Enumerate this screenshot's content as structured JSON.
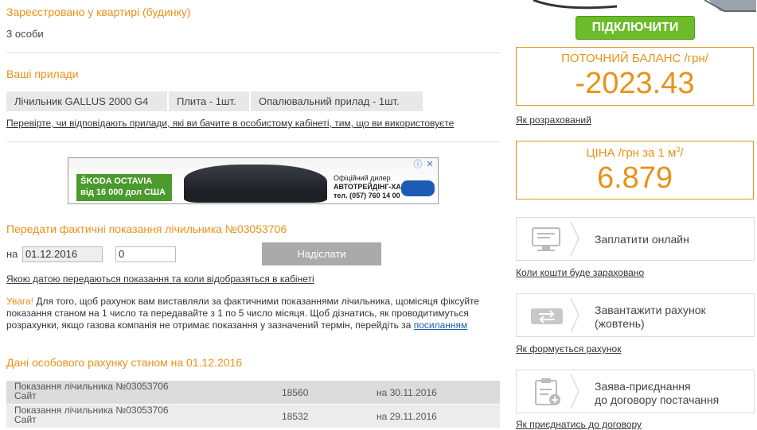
{
  "registered": {
    "heading": "Зареєстровано у квартирі (будинку)",
    "value": "3 особи"
  },
  "devices": {
    "heading": "Ваші прилади",
    "items": [
      "Лічильник GALLUS 2000 G4",
      "Плита - 1шт.",
      "Опалювальний прилад - 1шт."
    ],
    "check_link": "Перевірте, чи відповідають прилади, які ви бачите в особистому кабінеті, тим, що ви використовуєте"
  },
  "ad": {
    "brand": "ŠKODA OCTAVIA",
    "offer": "від 16 000 дол США",
    "dealer_label": "Офіційний дилер",
    "dealer_name": "АВТОТРЕЙДІНГ-ХАРКІВ",
    "phone": "тел. (057) 760 14 00",
    "info_icon": "info-icon",
    "close_icon": "close-icon"
  },
  "reading_form": {
    "heading": "Передати фактичні показання лічильника №03053706",
    "date_prefix": "на",
    "date_value": "01.12.2016",
    "reading_value": "0",
    "submit_label": "Надіслати",
    "help_link": "Якою датою передаються показання та коли відобразяться в кабінеті"
  },
  "notice": {
    "warn": "Увага!",
    "text": " Для того, щоб рахунок вам виставляли за фактичними показаннями лічильника, щомісяця фіксуйте показання станом на 1 число та передавайте з 1 по 5 число місяця. Щоб дізнатись, як проводитимуться розрахунки, якщо газова компанія не отримає показання у зазначений термін, перейдіть за ",
    "link": "посиланням"
  },
  "account": {
    "heading": "Дані особового рахунку станом на 01.12.2016",
    "rows": [
      {
        "title": "Показання лічильника №03053706",
        "source": "Сайт",
        "value": "18560",
        "date": "на 30.11.2016"
      },
      {
        "title": "Показання лічильника №03053706",
        "source": "Сайт",
        "value": "18532",
        "date": "на 29.11.2016"
      }
    ]
  },
  "sidebar": {
    "connect_label": "ПІДКЛЮЧИТИ",
    "balance": {
      "title": "ПОТОЧНИЙ БАЛАНС /грн/",
      "value": "-2023.43",
      "link": "Як розрахований"
    },
    "price": {
      "title_main": "ЦІНА /грн за 1 м",
      "title_sup": "3",
      "title_end": "/",
      "value": "6.879"
    },
    "pay": {
      "label": "Заплатити онлайн",
      "link": "Коли кошти буде зараховано",
      "icon": "computer-icon"
    },
    "bill": {
      "label_line1": "Завантажити рахунок",
      "label_line2": "(жовтень)",
      "link": "Як формується рахунок",
      "icon": "exchange-icon"
    },
    "contract": {
      "label_line1": "Заява-приєднання",
      "label_line2": "до договору постачання",
      "link": "Як приєднатись до договору",
      "icon": "clipboard-icon"
    }
  },
  "colors": {
    "accent": "#e8921a",
    "green": "#6cbc2a",
    "gray_button": "#aaaaaa",
    "row_bg": "#dddddd"
  }
}
